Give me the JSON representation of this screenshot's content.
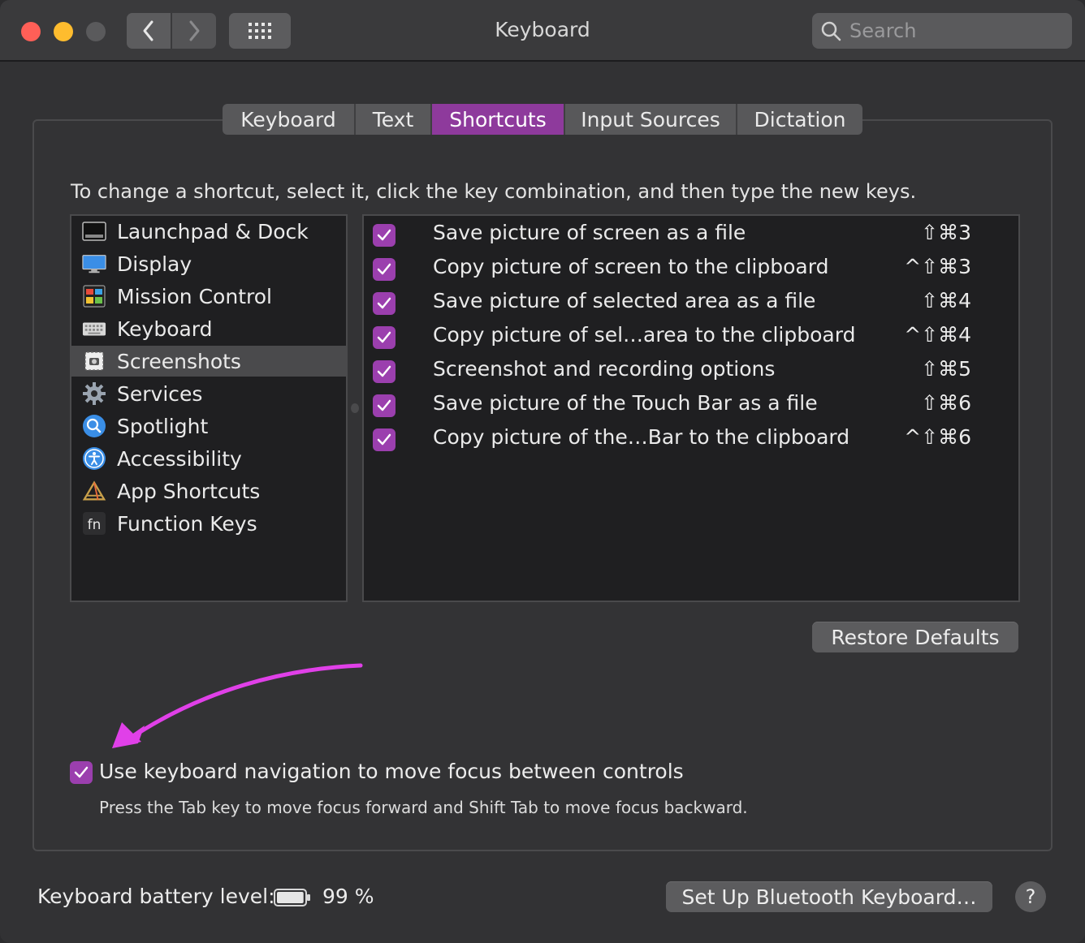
{
  "window": {
    "title": "Keyboard",
    "search": {
      "placeholder": "Search",
      "value": ""
    },
    "accent": "#9b3fae"
  },
  "tabs": [
    {
      "label": "Keyboard",
      "active": false
    },
    {
      "label": "Text",
      "active": false
    },
    {
      "label": "Shortcuts",
      "active": true
    },
    {
      "label": "Input Sources",
      "active": false
    },
    {
      "label": "Dictation",
      "active": false
    }
  ],
  "instructions": "To change a shortcut, select it, click the key combination, and then type the new keys.",
  "categories": [
    {
      "label": "Launchpad & Dock",
      "icon": "launchpad-dock-icon",
      "selected": false
    },
    {
      "label": "Display",
      "icon": "display-icon",
      "selected": false
    },
    {
      "label": "Mission Control",
      "icon": "mission-control-icon",
      "selected": false
    },
    {
      "label": "Keyboard",
      "icon": "keyboard-icon",
      "selected": false
    },
    {
      "label": "Screenshots",
      "icon": "screenshots-icon",
      "selected": true
    },
    {
      "label": "Services",
      "icon": "gear-icon",
      "selected": false
    },
    {
      "label": "Spotlight",
      "icon": "spotlight-search-icon",
      "selected": false
    },
    {
      "label": "Accessibility",
      "icon": "accessibility-icon",
      "selected": false
    },
    {
      "label": "App Shortcuts",
      "icon": "app-shortcuts-icon",
      "selected": false
    },
    {
      "label": "Function Keys",
      "icon": "fn-key-icon",
      "selected": false
    }
  ],
  "shortcuts": [
    {
      "label": "Save picture of screen as a file",
      "keys": "⇧⌘3",
      "checked": true
    },
    {
      "label": "Copy picture of screen to the clipboard",
      "keys": "^⇧⌘3",
      "checked": true
    },
    {
      "label": "Save picture of selected area as a file",
      "keys": "⇧⌘4",
      "checked": true
    },
    {
      "label": "Copy picture of sel…area to the clipboard",
      "keys": "^⇧⌘4",
      "checked": true
    },
    {
      "label": "Screenshot and recording options",
      "keys": "⇧⌘5",
      "checked": true
    },
    {
      "label": "Save picture of the Touch Bar as a file",
      "keys": "⇧⌘6",
      "checked": true
    },
    {
      "label": "Copy picture of the…Bar to the clipboard",
      "keys": "^⇧⌘6",
      "checked": true
    }
  ],
  "restore_defaults": "Restore Defaults",
  "keyboard_navigation": {
    "label": "Use keyboard navigation to move focus between controls",
    "checked": true,
    "description": "Press the Tab key to move focus forward and Shift Tab to move focus backward."
  },
  "battery": {
    "label": "Keyboard battery level:",
    "value": "99 %",
    "level": 0.99
  },
  "bluetooth_button": "Set Up Bluetooth Keyboard…",
  "help_button": "?",
  "annotation": {
    "color": "#e040e8"
  }
}
